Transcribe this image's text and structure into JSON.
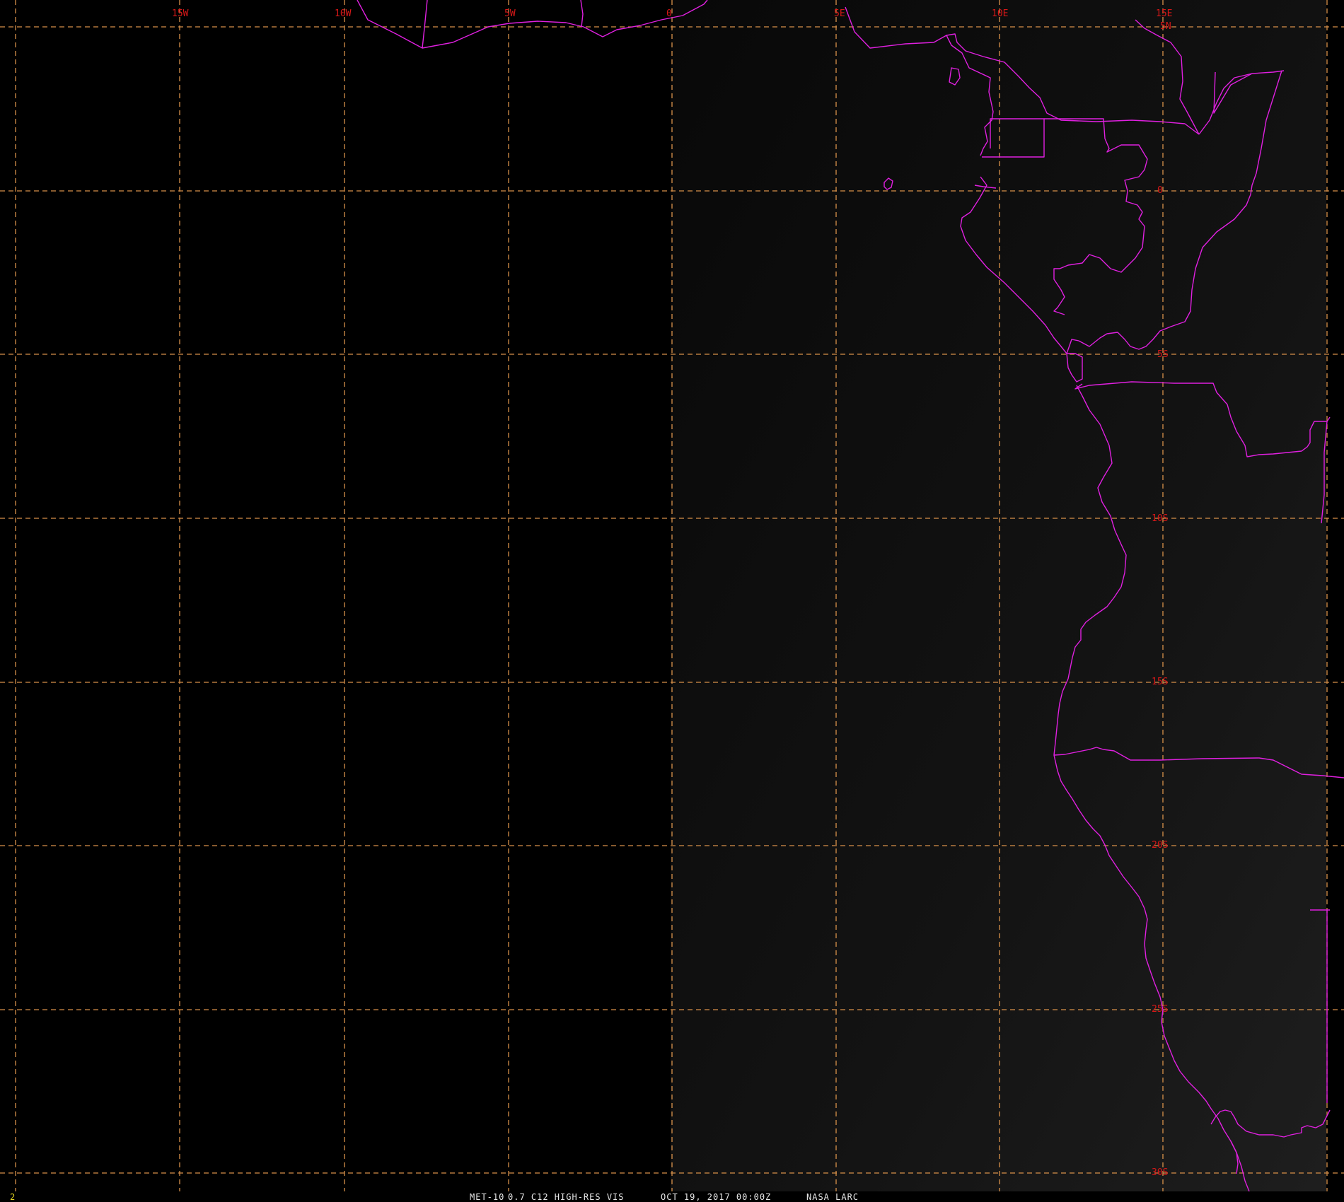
{
  "image": {
    "satellite": "MET-10",
    "channel": "0.7 C12 HIGH-RES VIS",
    "datetime": "OCT 19, 2017 00:00Z",
    "credit": "NASA LARC",
    "frame_number": "2"
  },
  "colors": {
    "background": "#000000",
    "grid": "#d8914a",
    "grid_label": "#d81818",
    "boundaries": "#e020e0",
    "footer_text": "#e8e8e8",
    "frame_number": "#e0d020"
  },
  "grid": {
    "longitude_labels": [
      "15W",
      "10W",
      "5W",
      "0",
      "5E",
      "10E",
      "15E"
    ],
    "latitude_labels": [
      "5N",
      "0",
      "5S",
      "10S",
      "15S",
      "20S",
      "25S",
      "30S"
    ]
  },
  "features": {
    "boundaries": "political-boundaries",
    "coastline": "west-africa-coastline"
  }
}
